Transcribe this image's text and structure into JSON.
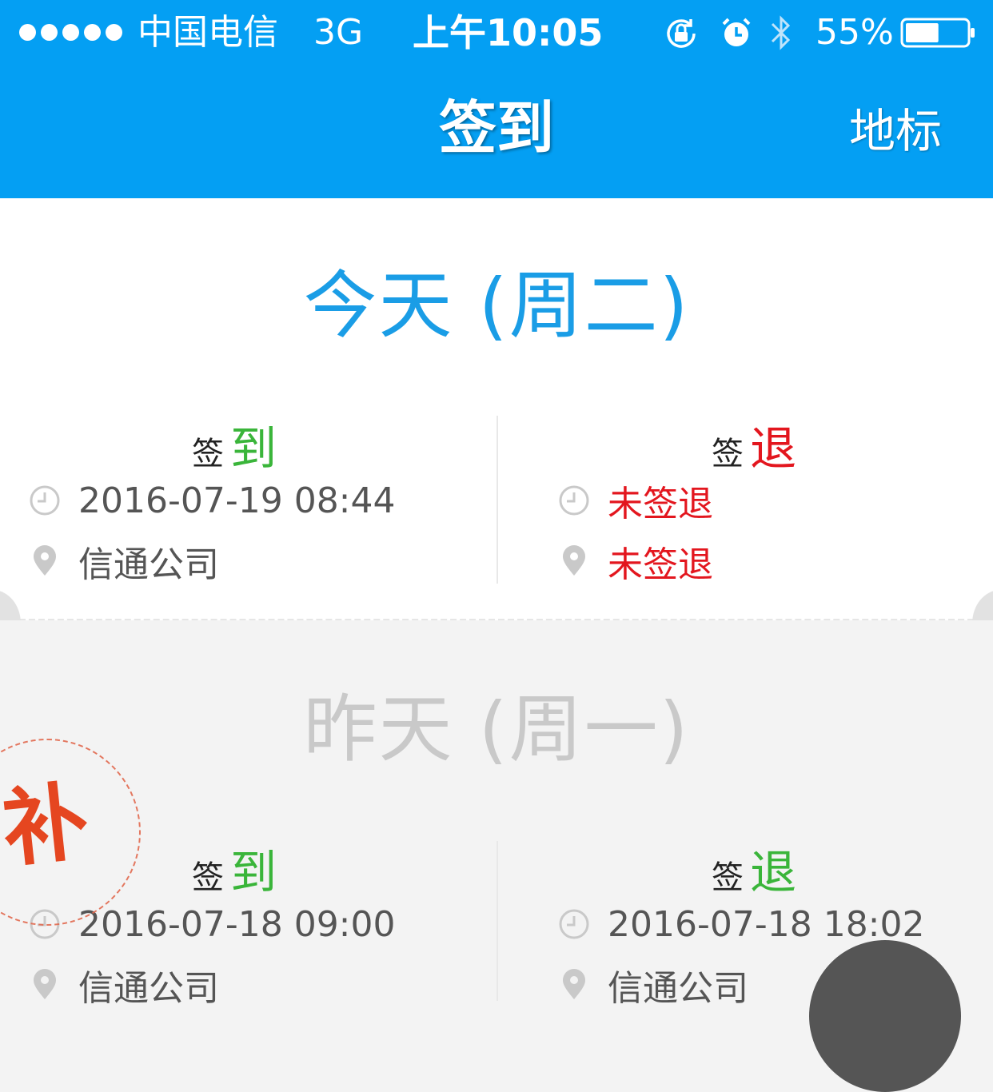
{
  "status_bar": {
    "signal_dots": 5,
    "carrier": "中国电信",
    "network": "3G",
    "time": "上午10:05",
    "battery": "55%",
    "battery_level": 0.55
  },
  "nav": {
    "title": "签到",
    "right_action": "地标"
  },
  "days": [
    {
      "title": "今天 (周二)",
      "checkin": {
        "head_small": "签",
        "head_big": "到",
        "time": "2016-07-19 08:44",
        "place": "信通公司"
      },
      "checkout": {
        "head_small": "签",
        "head_big": "退",
        "time": "未签退",
        "place": "未签退"
      }
    },
    {
      "title": "昨天 (周一)",
      "stamp": "补",
      "checkin": {
        "head_small": "签",
        "head_big": "到",
        "time": "2016-07-18 09:00",
        "place": "信通公司"
      },
      "checkout": {
        "head_small": "签",
        "head_big": "退",
        "time": "2016-07-18 18:02",
        "place": "信通公司"
      }
    }
  ],
  "colors": {
    "header_bg": "#049ff3",
    "today_title": "#1a9de6",
    "green": "#3ab53a",
    "red": "#e3161e"
  }
}
